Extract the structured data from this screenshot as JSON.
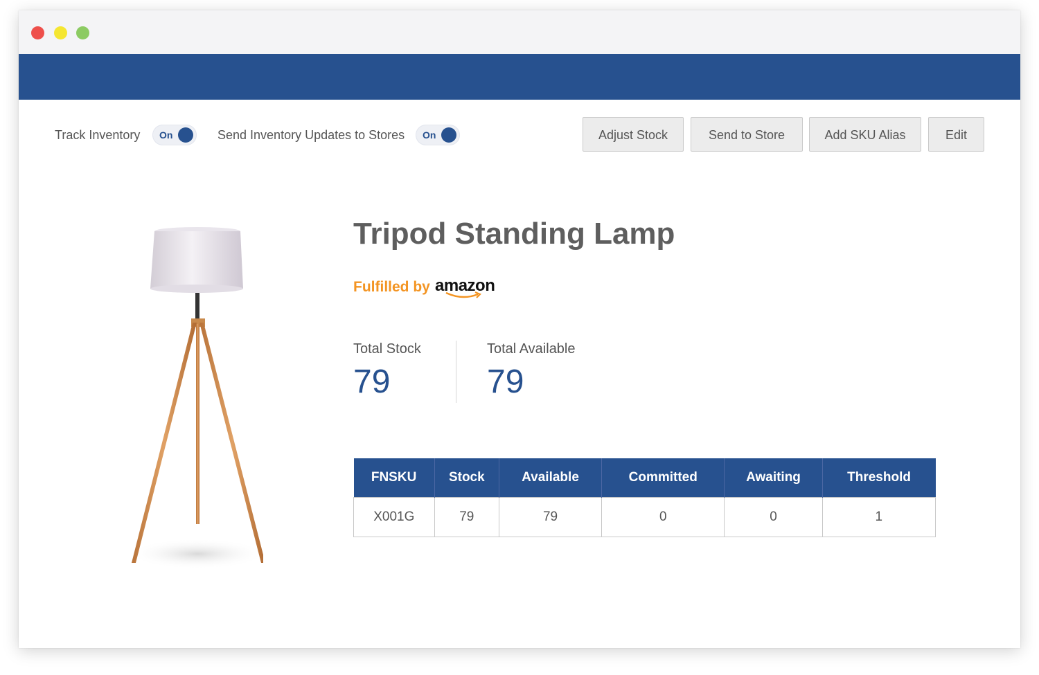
{
  "colors": {
    "brand_blue": "#27518F",
    "accent_orange": "#F39422",
    "window_red": "#EE4F4B",
    "window_yellow": "#F5E631",
    "window_green": "#8CCB62"
  },
  "toolbar": {
    "track_inventory_label": "Track Inventory",
    "track_inventory_toggle": "On",
    "send_updates_label": "Send Inventory Updates to Stores",
    "send_updates_toggle": "On",
    "adjust_stock_label": "Adjust Stock",
    "send_to_store_label": "Send to Store",
    "add_sku_alias_label": "Add SKU Alias",
    "edit_label": "Edit"
  },
  "product": {
    "name": "Tripod Standing Lamp",
    "fulfilled_by_label": "Fulfilled by",
    "fulfilled_by_brand": "amazon"
  },
  "metrics": {
    "total_stock_label": "Total Stock",
    "total_stock_value": "79",
    "total_available_label": "Total Available",
    "total_available_value": "79"
  },
  "table": {
    "headers": [
      "FNSKU",
      "Stock",
      "Available",
      "Committed",
      "Awaiting",
      "Threshold"
    ],
    "rows": [
      [
        "X001G",
        "79",
        "79",
        "0",
        "0",
        "1"
      ]
    ]
  }
}
